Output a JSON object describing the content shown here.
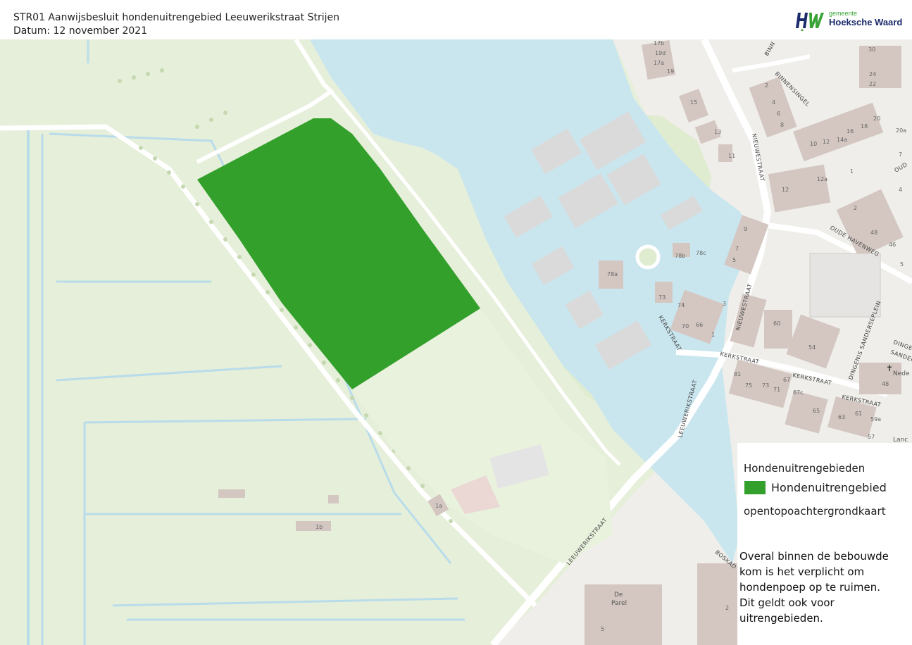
{
  "header": {
    "title": "STR01 Aanwijsbesluit hondenuitrengebied Leeuwerikstraat Strijen",
    "date": "Datum: 12 november 2021"
  },
  "logo": {
    "small": "gemeente",
    "big": "Hoeksche Waard",
    "colors": {
      "green": "#3aa335",
      "blue": "#1b2a6b"
    }
  },
  "legend": {
    "heading": "Hondenuitrengebieden",
    "item_label": "Hondenuitrengebied",
    "item_color": "#33a02c",
    "basemap": "opentopoachtergrondkaart",
    "note": "Overal binnen de bebouwde\nkom is het verplicht om\nhondenpoep op te ruimen.\n Dit geldt ook voor\nuitrengebieden."
  },
  "map": {
    "colors": {
      "water": "#c9e6ef",
      "land": "#e6efd9",
      "urban": "#efeeea",
      "building": "#d4c7c2",
      "dog_area": "#33a02c"
    },
    "streets": {
      "nieuwestraat_upper": "NIEUWESTRAAT",
      "binnensingel": "BINNENSINGEL",
      "oude_havenweg": "OUDE HAVENWEG",
      "oud": "OUD",
      "binn": "BINN",
      "nieuwestraat_lower": "NIEUWESTRAAT",
      "kerkstraat_1": "KERKSTRAAT",
      "kerkstraat_2": "KERKSTRAAT",
      "kerkstraat_3": "KERKSTRAAT",
      "kerkstraat_4": "KERKSTRAAT",
      "leeuwerikstraat_1": "LEEUWERIKSTRAAT",
      "leeuwerikstraat_2": "LEEUWERIKSTRAAT",
      "dingenis": "DINGENIS SANDERSEPLEIN",
      "dinge": "DINGE",
      "sanderse": "SANDERSE",
      "boskade": "BOSKAD"
    },
    "places": {
      "nede": "Nede",
      "lanc": "Lanc",
      "de": "De",
      "parel": "Parel"
    },
    "house_numbers": [
      "17b",
      "19d",
      "17a",
      "19",
      "15",
      "13",
      "11",
      "2",
      "4",
      "6",
      "8",
      "10",
      "12",
      "14a",
      "16",
      "18",
      "20",
      "12",
      "12a",
      "1",
      "9",
      "7",
      "5",
      "3",
      "1",
      "78b",
      "78c",
      "78a",
      "74",
      "70",
      "66",
      "73",
      "60",
      "54",
      "81",
      "75",
      "73",
      "71",
      "67",
      "67c",
      "65",
      "63",
      "61",
      "59a",
      "57",
      "46",
      "48",
      "4",
      "2",
      "30",
      "24",
      "22",
      "20a",
      "7",
      "5",
      "1a",
      "1b",
      "48",
      "2",
      "5"
    ]
  }
}
